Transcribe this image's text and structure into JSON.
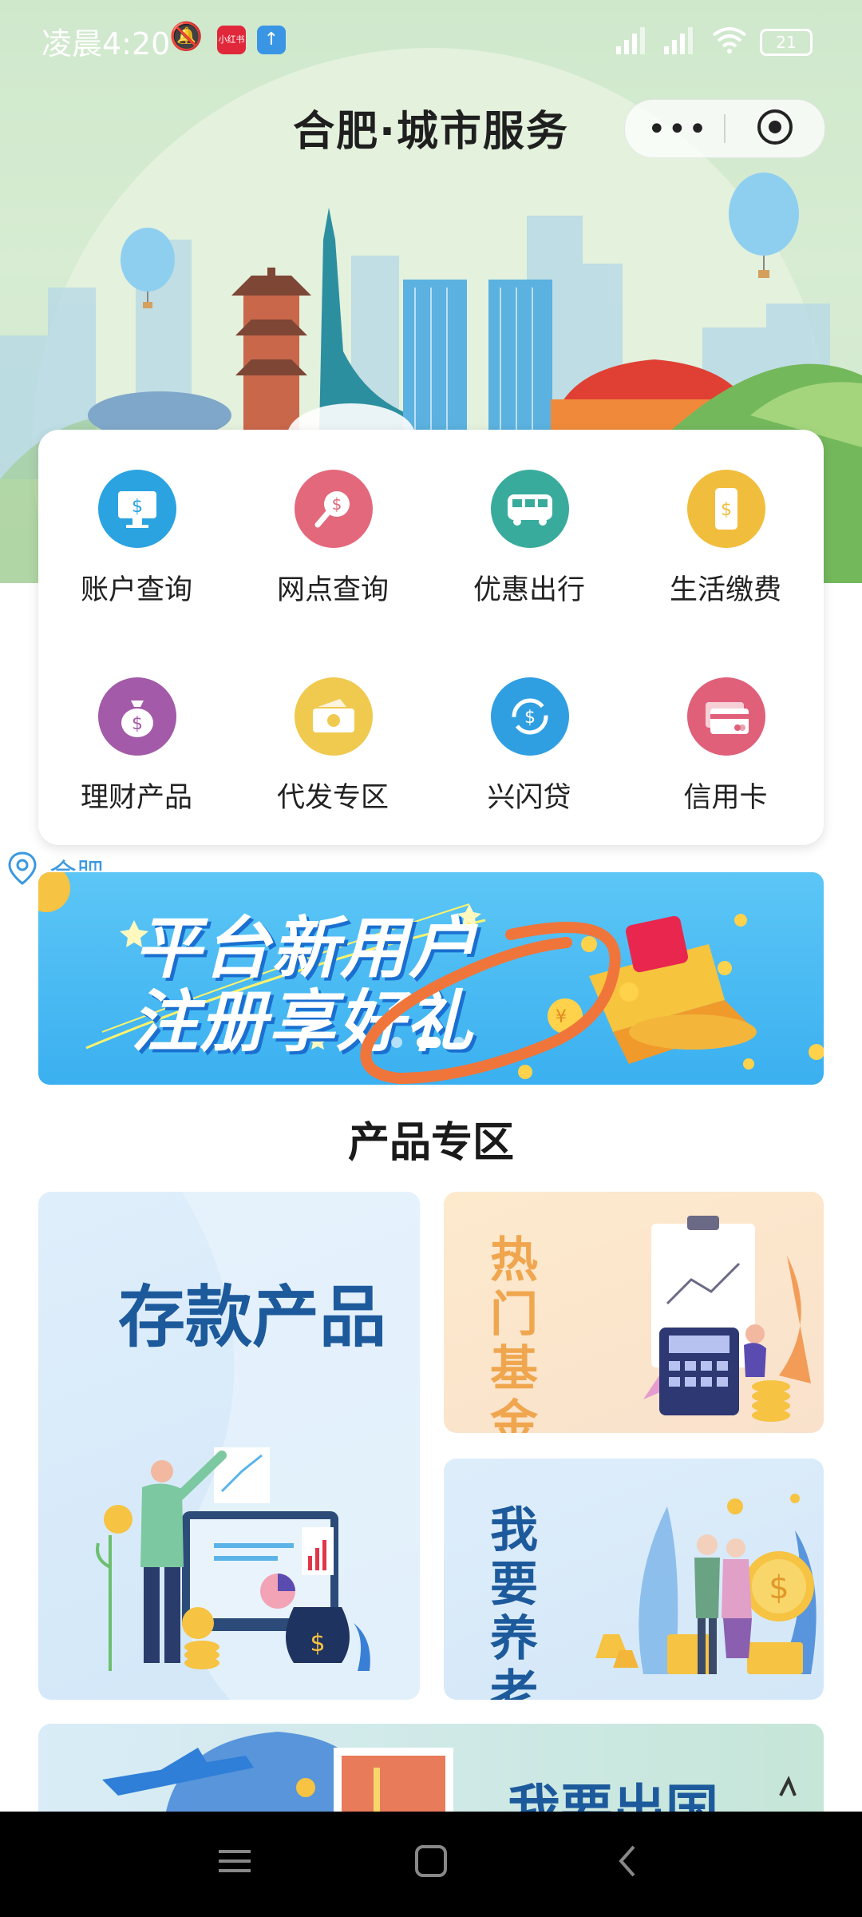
{
  "status_bar": {
    "time": "凌晨4:20",
    "app_badge": "小红书",
    "battery": "21"
  },
  "header": {
    "title": "合肥·城市服务"
  },
  "services": [
    {
      "label": "账户查询",
      "icon": "computer-dollar-icon",
      "color": "#2aa3e0"
    },
    {
      "label": "网点查询",
      "icon": "search-dollar-icon",
      "color": "#e3687b"
    },
    {
      "label": "优惠出行",
      "icon": "bus-icon",
      "color": "#39ab9c"
    },
    {
      "label": "生活缴费",
      "icon": "phone-dollar-icon",
      "color": "#f1bd3c"
    },
    {
      "label": "理财产品",
      "icon": "money-bag-icon",
      "color": "#a35aa8"
    },
    {
      "label": "代发专区",
      "icon": "cash-icon",
      "color": "#f0c94f"
    },
    {
      "label": "兴闪贷",
      "icon": "cycle-dollar-icon",
      "color": "#2f9fe2"
    },
    {
      "label": "信用卡",
      "icon": "credit-card-icon",
      "color": "#e0607a"
    }
  ],
  "location": {
    "city": "合肥"
  },
  "banner": {
    "line1": "平台新用户",
    "line2": "注册享好礼",
    "active_slide": 2,
    "slide_count": 3
  },
  "products": {
    "section_title": "产品专区",
    "items": [
      {
        "label": "存款产品"
      },
      {
        "label": "热门基金"
      },
      {
        "label": "我要养老"
      },
      {
        "label": "我要出国"
      }
    ]
  }
}
